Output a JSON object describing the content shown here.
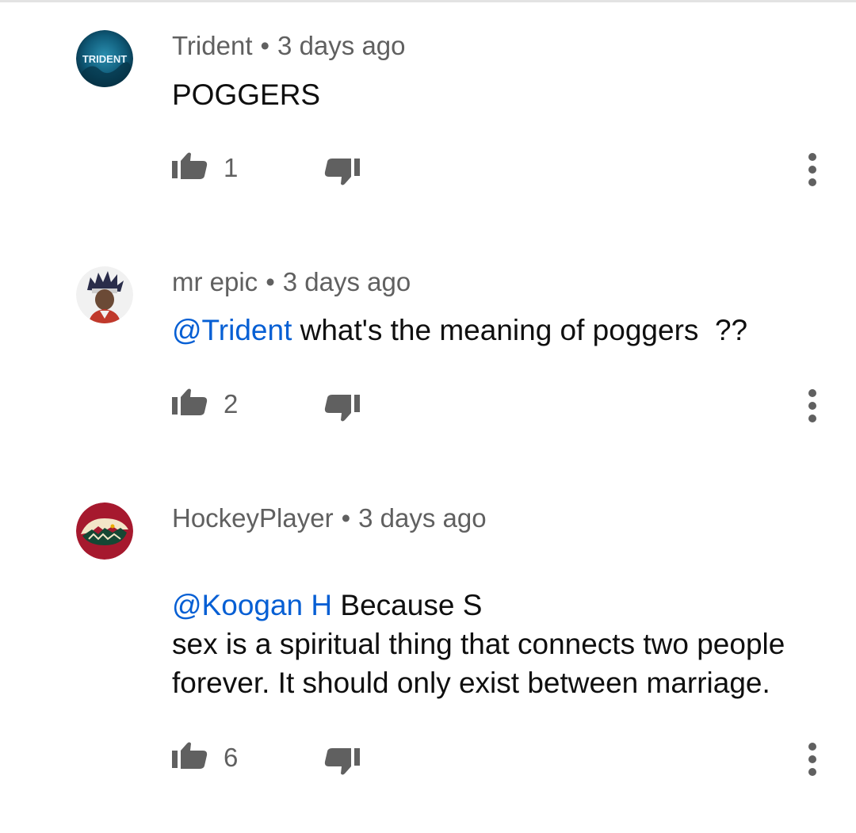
{
  "comments": [
    {
      "author": "Trident",
      "separator": "•",
      "time": "3 days ago",
      "avatar_text": "TRIDENT",
      "mention": "",
      "text": "POGGERS",
      "likes": "1"
    },
    {
      "author": "mr epic",
      "separator": "•",
      "time": "3 days ago",
      "mention": "@Trident",
      "text": " what's the meaning of poggers  ??",
      "likes": "2"
    },
    {
      "author": "HockeyPlayer",
      "separator": "•",
      "time": "3 days ago",
      "mention": "@Koogan H",
      "text": " Because S\nsex is a spiritual thing that connects two people forever. It should only exist between marriage.",
      "likes": "6"
    }
  ],
  "icons": {
    "like": "thumb-up-icon",
    "dislike": "thumb-down-icon",
    "more": "more-vert-icon"
  },
  "colors": {
    "mention": "#065fd4",
    "meta": "#606060",
    "icon": "#606060"
  }
}
